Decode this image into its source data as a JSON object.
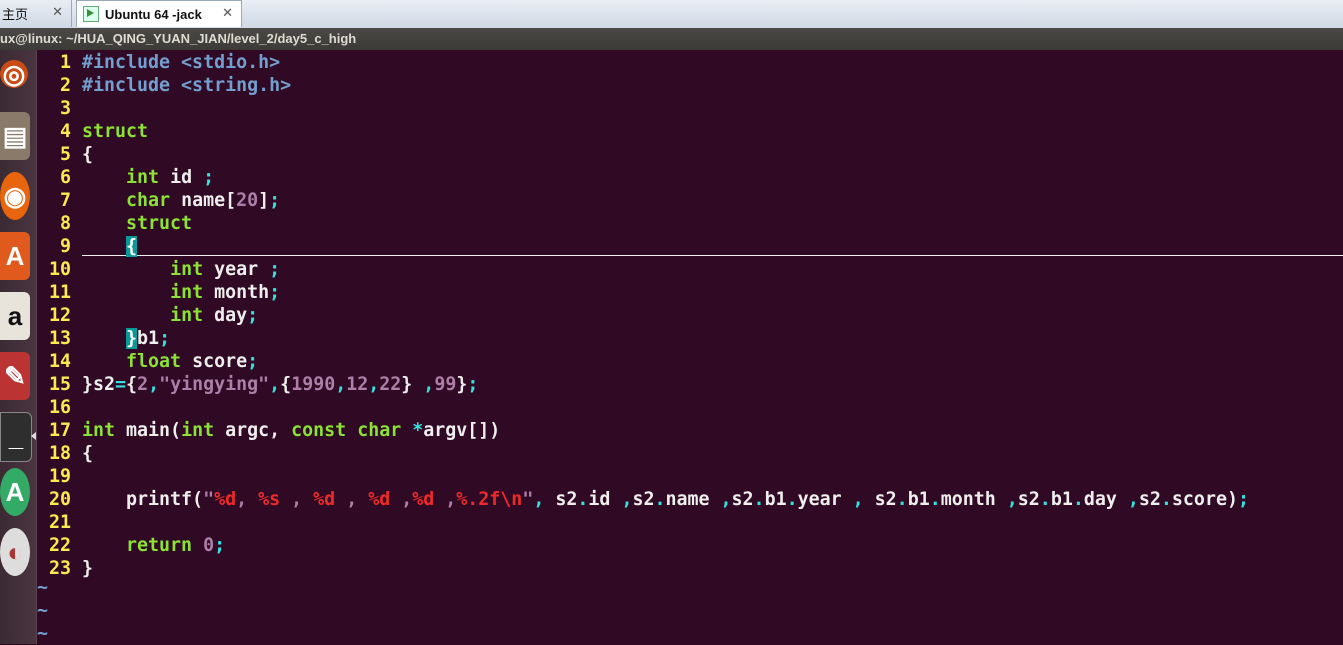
{
  "tabs": [
    {
      "label": "主页"
    },
    {
      "label": "Ubuntu 64 -jack"
    }
  ],
  "window_title": "ux@linux: ~/HUA_QING_YUAN_JIAN/level_2/day5_c_high",
  "colors": {
    "background": "#300a24",
    "line_number": "#fce94f",
    "preprocessor": "#729fcf",
    "keyword": "#8ae234",
    "constant": "#ad7fa8",
    "special": "#ef2929",
    "operator": "#34e2e2",
    "text": "#eeeeec"
  },
  "launcher_icons": [
    "dash-icon",
    "files-icon",
    "firefox-icon",
    "software-center-icon",
    "amazon-icon",
    "settings-icon",
    "terminal-icon",
    "update-manager-icon",
    "dvd-icon"
  ],
  "code_lines": [
    {
      "n": "1",
      "tokens": [
        [
          "pp",
          "#include <stdio.h>"
        ]
      ]
    },
    {
      "n": "2",
      "tokens": [
        [
          "pp",
          "#include <string.h>"
        ]
      ]
    },
    {
      "n": "3",
      "tokens": []
    },
    {
      "n": "4",
      "tokens": [
        [
          "kw",
          "struct"
        ]
      ]
    },
    {
      "n": "5",
      "tokens": [
        [
          "tx",
          "{"
        ]
      ]
    },
    {
      "n": "6",
      "tokens": [
        [
          "tx",
          "    "
        ],
        [
          "kw",
          "int"
        ],
        [
          "tx",
          " id "
        ],
        [
          "op",
          ";"
        ]
      ]
    },
    {
      "n": "7",
      "tokens": [
        [
          "tx",
          "    "
        ],
        [
          "kw",
          "char"
        ],
        [
          "tx",
          " name["
        ],
        [
          "num",
          "20"
        ],
        [
          "tx",
          "]"
        ],
        [
          "op",
          ";"
        ]
      ]
    },
    {
      "n": "8",
      "tokens": [
        [
          "tx",
          "    "
        ],
        [
          "kw",
          "struct"
        ]
      ]
    },
    {
      "n": "9",
      "tokens": [
        [
          "tx",
          "    "
        ],
        [
          "hl",
          "{"
        ]
      ]
    },
    {
      "n": "10",
      "tokens": [
        [
          "tx",
          "        "
        ],
        [
          "kw",
          "int"
        ],
        [
          "tx",
          " year "
        ],
        [
          "op",
          ";"
        ]
      ]
    },
    {
      "n": "11",
      "tokens": [
        [
          "tx",
          "        "
        ],
        [
          "kw",
          "int"
        ],
        [
          "tx",
          " month"
        ],
        [
          "op",
          ";"
        ]
      ]
    },
    {
      "n": "12",
      "tokens": [
        [
          "tx",
          "        "
        ],
        [
          "kw",
          "int"
        ],
        [
          "tx",
          " day"
        ],
        [
          "op",
          ";"
        ]
      ]
    },
    {
      "n": "13",
      "tokens": [
        [
          "tx",
          "    "
        ],
        [
          "hl",
          "}"
        ],
        [
          "tx",
          "b1"
        ],
        [
          "op",
          ";"
        ]
      ]
    },
    {
      "n": "14",
      "tokens": [
        [
          "tx",
          "    "
        ],
        [
          "kw",
          "float"
        ],
        [
          "tx",
          " score"
        ],
        [
          "op",
          ";"
        ]
      ]
    },
    {
      "n": "15",
      "tokens": [
        [
          "tx",
          "}s2"
        ],
        [
          "op",
          "="
        ],
        [
          "tx",
          "{"
        ],
        [
          "num",
          "2"
        ],
        [
          "op",
          ","
        ],
        [
          "str",
          "\"yingying\""
        ],
        [
          "op",
          ","
        ],
        [
          "tx",
          "{"
        ],
        [
          "num",
          "1990"
        ],
        [
          "op",
          ","
        ],
        [
          "num",
          "12"
        ],
        [
          "op",
          ","
        ],
        [
          "num",
          "22"
        ],
        [
          "tx",
          "} "
        ],
        [
          "op",
          ","
        ],
        [
          "num",
          "99"
        ],
        [
          "tx",
          "}"
        ],
        [
          "op",
          ";"
        ]
      ]
    },
    {
      "n": "16",
      "tokens": []
    },
    {
      "n": "17",
      "tokens": [
        [
          "kw",
          "int"
        ],
        [
          "tx",
          " main("
        ],
        [
          "kw",
          "int"
        ],
        [
          "tx",
          " argc, "
        ],
        [
          "kw",
          "const"
        ],
        [
          "tx",
          " "
        ],
        [
          "kw",
          "char"
        ],
        [
          "tx",
          " "
        ],
        [
          "op",
          "*"
        ],
        [
          "tx",
          "argv[])"
        ]
      ]
    },
    {
      "n": "18",
      "tokens": [
        [
          "tx",
          "{"
        ]
      ]
    },
    {
      "n": "19",
      "tokens": []
    },
    {
      "n": "20",
      "tokens": [
        [
          "tx",
          "    printf("
        ],
        [
          "str",
          "\""
        ],
        [
          "fmt",
          "%d"
        ],
        [
          "str",
          ", "
        ],
        [
          "fmt",
          "%s"
        ],
        [
          "str",
          " , "
        ],
        [
          "fmt",
          "%d"
        ],
        [
          "str",
          " , "
        ],
        [
          "fmt",
          "%d"
        ],
        [
          "str",
          " ,"
        ],
        [
          "fmt",
          "%d"
        ],
        [
          "str",
          " ,"
        ],
        [
          "fmt",
          "%.2f\\n"
        ],
        [
          "str",
          "\""
        ],
        [
          "op",
          ","
        ],
        [
          "tx",
          " s2"
        ],
        [
          "op",
          "."
        ],
        [
          "tx",
          "id "
        ],
        [
          "op",
          ","
        ],
        [
          "tx",
          "s2"
        ],
        [
          "op",
          "."
        ],
        [
          "tx",
          "name "
        ],
        [
          "op",
          ","
        ],
        [
          "tx",
          "s2"
        ],
        [
          "op",
          "."
        ],
        [
          "tx",
          "b1"
        ],
        [
          "op",
          "."
        ],
        [
          "tx",
          "year "
        ],
        [
          "op",
          ","
        ],
        [
          "tx",
          " s2"
        ],
        [
          "op",
          "."
        ],
        [
          "tx",
          "b1"
        ],
        [
          "op",
          "."
        ],
        [
          "tx",
          "month "
        ],
        [
          "op",
          ","
        ],
        [
          "tx",
          "s2"
        ],
        [
          "op",
          "."
        ],
        [
          "tx",
          "b1"
        ],
        [
          "op",
          "."
        ],
        [
          "tx",
          "day "
        ],
        [
          "op",
          ","
        ],
        [
          "tx",
          "s2"
        ],
        [
          "op",
          "."
        ],
        [
          "tx",
          "score)"
        ],
        [
          "op",
          ";"
        ]
      ]
    },
    {
      "n": "21",
      "tokens": []
    },
    {
      "n": "22",
      "tokens": [
        [
          "tx",
          "    "
        ],
        [
          "kw",
          "return"
        ],
        [
          "tx",
          " "
        ],
        [
          "num",
          "0"
        ],
        [
          "op",
          ";"
        ]
      ]
    },
    {
      "n": "23",
      "tokens": [
        [
          "tx",
          "}"
        ]
      ]
    }
  ],
  "tilde_lines": [
    "~",
    "~",
    "~"
  ]
}
